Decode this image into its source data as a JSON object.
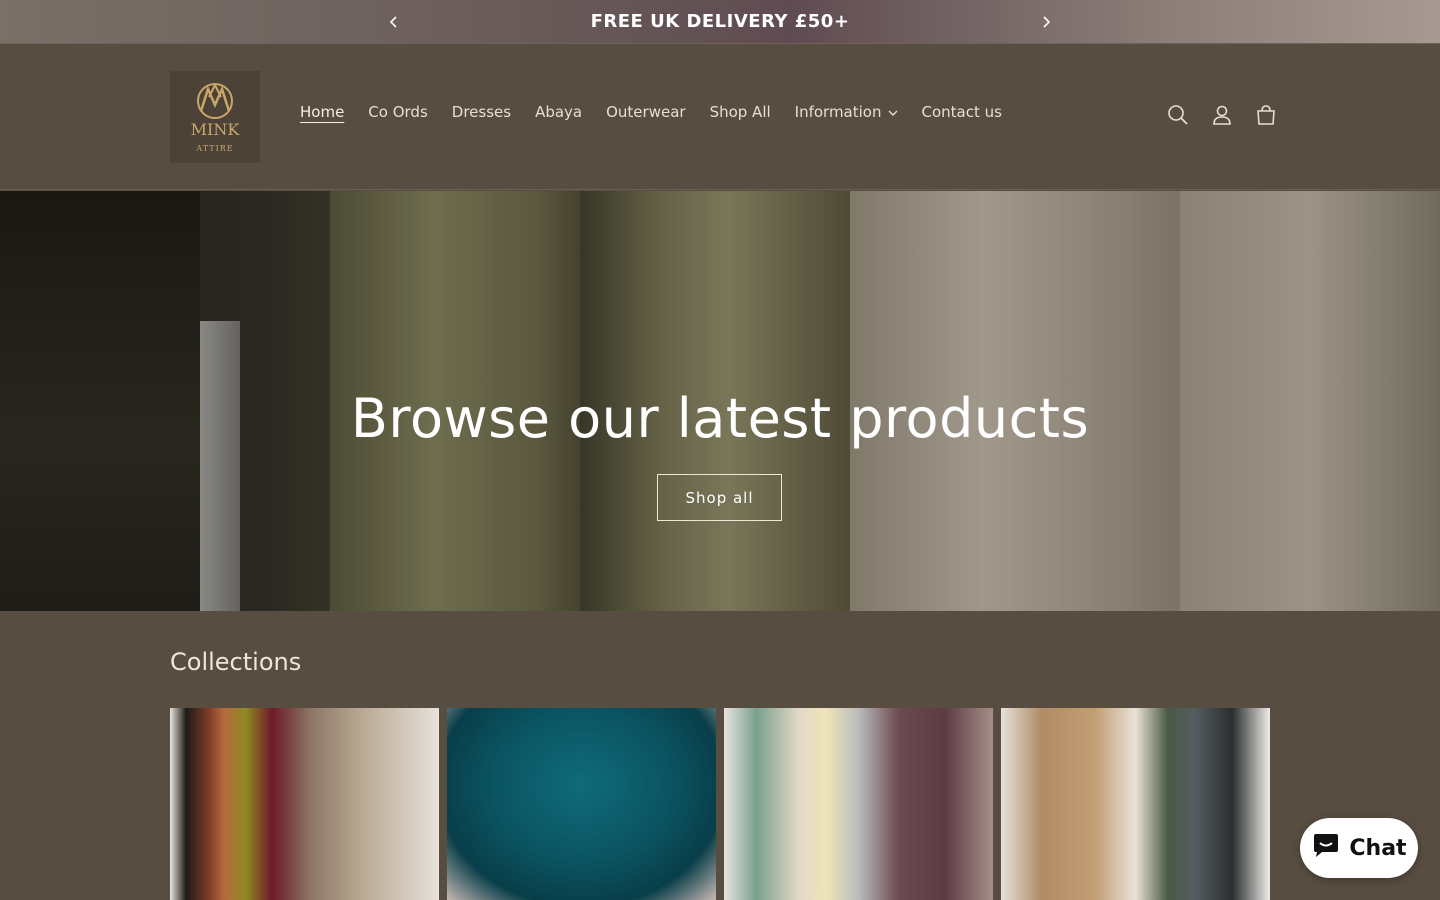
{
  "announcement": {
    "text": "FREE UK DELIVERY £50+",
    "prev_icon": "chevron-left-icon",
    "next_icon": "chevron-right-icon"
  },
  "header": {
    "logo_lines": [
      "MINK",
      "ATTIRE"
    ],
    "nav": [
      "Home",
      "Co Ords",
      "Dresses",
      "Abaya",
      "Outerwear",
      "Shop All",
      "Information",
      "Contact us"
    ],
    "icons": [
      "search-icon",
      "account-icon",
      "cart-icon"
    ]
  },
  "hero": {
    "title": "Browse our latest products",
    "button": "Shop all"
  },
  "collections": {
    "title": "Collections"
  },
  "chat": {
    "label": "Chat"
  },
  "colors": {
    "background": "#584d41",
    "text": "#f3ece2",
    "chat_bg": "#ffffff"
  }
}
